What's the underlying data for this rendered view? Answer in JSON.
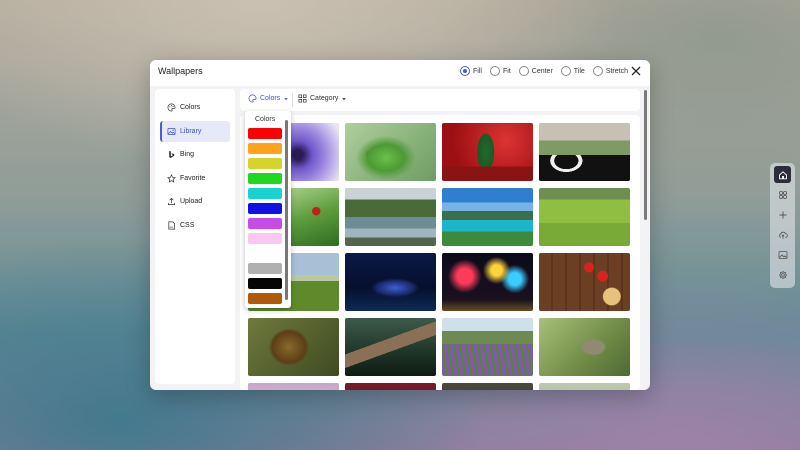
{
  "window": {
    "title": "Wallpapers"
  },
  "fit_options": [
    {
      "label": "Fill",
      "checked": true
    },
    {
      "label": "Fit",
      "checked": false
    },
    {
      "label": "Center",
      "checked": false
    },
    {
      "label": "Tile",
      "checked": false
    },
    {
      "label": "Stretch",
      "checked": false
    }
  ],
  "sidebar": {
    "items": [
      {
        "label": "Colors",
        "icon": "palette-icon",
        "active": false
      },
      {
        "label": "Library",
        "icon": "image-icon",
        "active": true
      },
      {
        "label": "Bing",
        "icon": "bing-icon",
        "active": false
      },
      {
        "label": "Favorite",
        "icon": "star-icon",
        "active": false
      },
      {
        "label": "Upload",
        "icon": "upload-icon",
        "active": false
      },
      {
        "label": "CSS",
        "icon": "css-file-icon",
        "active": false
      }
    ]
  },
  "toolbar": {
    "colors_label": "Colors",
    "category_label": "Category"
  },
  "color_dropdown": {
    "label": "Colors",
    "swatches": [
      "#ff0000",
      "#ffa31a",
      "#d4d42a",
      "#1fd81f",
      "#19d2d2",
      "#1010e6",
      "#c84be8",
      "#f9c8f0",
      "#ffffff",
      "#b0b0b0",
      "#050505",
      "#b05a08"
    ]
  },
  "theme": {
    "accent": "#4a5bd8",
    "active_bg": "#e6e9f8"
  }
}
